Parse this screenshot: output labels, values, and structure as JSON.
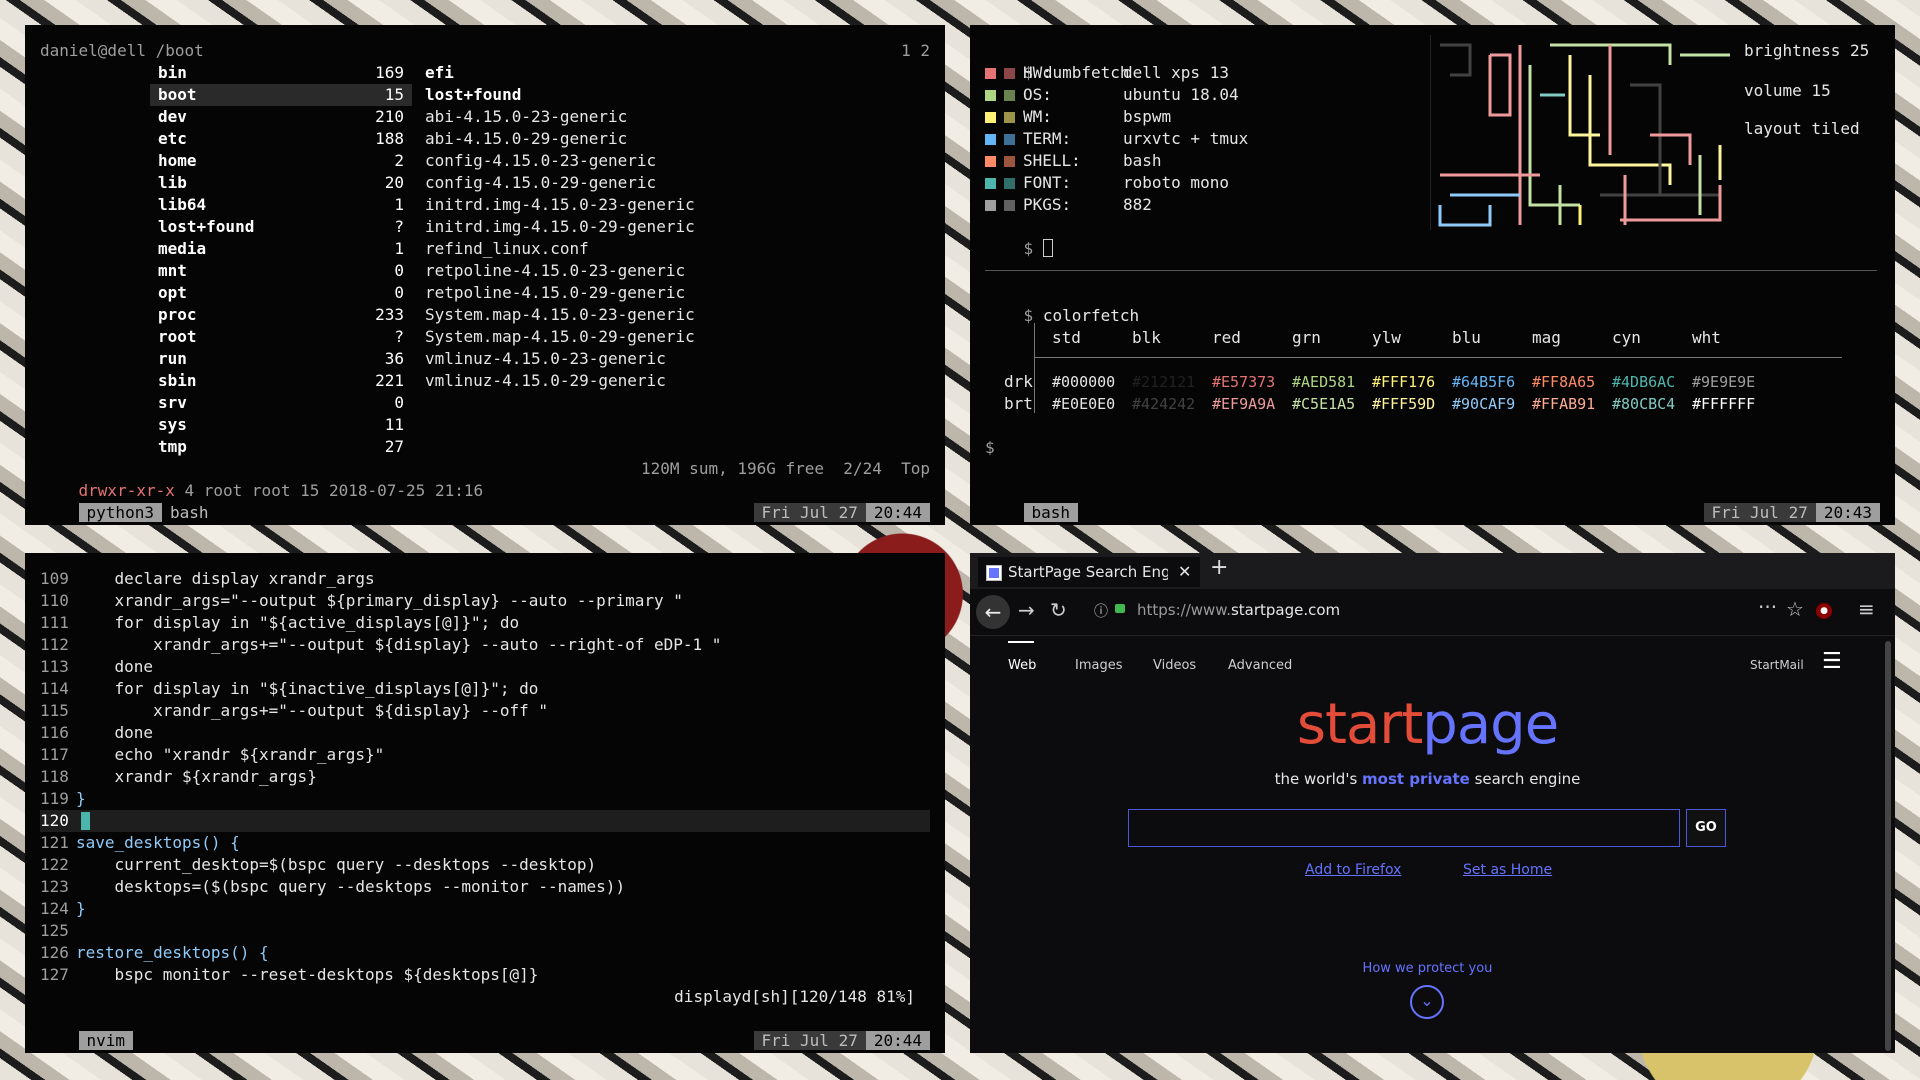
{
  "ranger": {
    "path": "daniel@dell /boot",
    "tabs": "1 2",
    "left_items": [
      {
        "name": "bin",
        "count": "169"
      },
      {
        "name": "boot",
        "count": "15",
        "selected": true
      },
      {
        "name": "dev",
        "count": "210"
      },
      {
        "name": "etc",
        "count": "188"
      },
      {
        "name": "home",
        "count": "2"
      },
      {
        "name": "lib",
        "count": "20"
      },
      {
        "name": "lib64",
        "count": "1"
      },
      {
        "name": "lost+found",
        "count": "?"
      },
      {
        "name": "media",
        "count": "1"
      },
      {
        "name": "mnt",
        "count": "0"
      },
      {
        "name": "opt",
        "count": "0"
      },
      {
        "name": "proc",
        "count": "233"
      },
      {
        "name": "root",
        "count": "?"
      },
      {
        "name": "run",
        "count": "36"
      },
      {
        "name": "sbin",
        "count": "221"
      },
      {
        "name": "srv",
        "count": "0"
      },
      {
        "name": "sys",
        "count": "11"
      },
      {
        "name": "tmp",
        "count": "27"
      }
    ],
    "right_items": [
      {
        "name": "efi",
        "bold": true
      },
      {
        "name": "lost+found",
        "bold": true
      },
      {
        "name": "abi-4.15.0-23-generic"
      },
      {
        "name": "abi-4.15.0-29-generic"
      },
      {
        "name": "config-4.15.0-23-generic"
      },
      {
        "name": "config-4.15.0-29-generic"
      },
      {
        "name": "initrd.img-4.15.0-23-generic"
      },
      {
        "name": "initrd.img-4.15.0-29-generic"
      },
      {
        "name": "refind_linux.conf"
      },
      {
        "name": "retpoline-4.15.0-23-generic"
      },
      {
        "name": "retpoline-4.15.0-29-generic"
      },
      {
        "name": "System.map-4.15.0-23-generic"
      },
      {
        "name": "System.map-4.15.0-29-generic"
      },
      {
        "name": "vmlinuz-4.15.0-23-generic"
      },
      {
        "name": "vmlinuz-4.15.0-29-generic"
      }
    ],
    "perm": "drwxr-xr-x",
    "info": " 4 root root 15 2018-07-25 21:16",
    "summary": "120M sum, 196G free  2/24  Top",
    "status_left": "python3",
    "status_left2": "bash",
    "date": "Fri Jul 27",
    "time": "20:44"
  },
  "fetch": {
    "prompt": "$",
    "cmd1": "dumbfetch",
    "items": [
      {
        "label": "HW:",
        "value": "dell xps 13",
        "color": "#E57373"
      },
      {
        "label": "OS:",
        "value": "ubuntu 18.04",
        "color": "#AED581"
      },
      {
        "label": "WM:",
        "value": "bspwm",
        "color": "#FFF176"
      },
      {
        "label": "TERM:",
        "value": "urxvtc + tmux",
        "color": "#64B5F6"
      },
      {
        "label": "SHELL:",
        "value": "bash",
        "color": "#FF8A65"
      },
      {
        "label": "FONT:",
        "value": "roboto mono",
        "color": "#4DB6AC"
      },
      {
        "label": "PKGS:",
        "value": "882",
        "color": "#9E9E9E"
      }
    ],
    "brightness": "brightness 25",
    "volume": "volume 15",
    "layout": "layout tiled",
    "cmd2": "colorfetch",
    "headers": [
      "std",
      "blk",
      "red",
      "grn",
      "ylw",
      "blu",
      "mag",
      "cyn",
      "wht"
    ],
    "drk_label": "drk",
    "brt_label": "brt",
    "drk": [
      "#000000",
      "#212121",
      "#E57373",
      "#AED581",
      "#FFF176",
      "#64B5F6",
      "#FF8A65",
      "#4DB6AC",
      "#9E9E9E"
    ],
    "brt": [
      "#E0E0E0",
      "#424242",
      "#EF9A9A",
      "#C5E1A5",
      "#FFF59D",
      "#90CAF9",
      "#FFAB91",
      "#80CBC4",
      "#FFFFFF"
    ],
    "status_left": "bash",
    "date": "Fri Jul 27",
    "time": "20:43"
  },
  "nvim": {
    "lines": [
      {
        "n": "109",
        "text": "    declare display xrandr_args"
      },
      {
        "n": "110",
        "text": "    xrandr_args=\"--output ${primary_display} --auto --primary \""
      },
      {
        "n": "111",
        "text": "    for display in \"${active_displays[@]}\"; do"
      },
      {
        "n": "112",
        "text": "        xrandr_args+=\"--output ${display} --auto --right-of eDP-1 \""
      },
      {
        "n": "113",
        "text": "    done"
      },
      {
        "n": "114",
        "text": "    for display in \"${inactive_displays[@]}\"; do"
      },
      {
        "n": "115",
        "text": "        xrandr_args+=\"--output ${display} --off \""
      },
      {
        "n": "116",
        "text": "    done"
      },
      {
        "n": "117",
        "text": "    echo \"xrandr ${xrandr_args}\""
      },
      {
        "n": "118",
        "text": "    xrandr ${xrandr_args}"
      },
      {
        "n": "119",
        "text": "}"
      },
      {
        "n": "120",
        "text": ""
      },
      {
        "n": "121",
        "text": "save_desktops() {"
      },
      {
        "n": "122",
        "text": "    current_desktop=$(bspc query --desktops --desktop)"
      },
      {
        "n": "123",
        "text": "    desktops=($(bspc query --desktops --monitor --names))"
      },
      {
        "n": "124",
        "text": "}"
      },
      {
        "n": "125",
        "text": ""
      },
      {
        "n": "126",
        "text": "restore_desktops() {"
      },
      {
        "n": "127",
        "text": "    bspc monitor --reset-desktops ${desktops[@]}"
      }
    ],
    "file_status": "displayd[sh][120/148 81%]",
    "status_left": "nvim",
    "date": "Fri Jul 27",
    "time": "20:44"
  },
  "browser": {
    "tab_title": "StartPage Search Engi",
    "url_prefix": "https://www.",
    "url_domain": "startpage.com",
    "nav_items": [
      "Web",
      "Images",
      "Videos",
      "Advanced"
    ],
    "startmail": "StartMail",
    "logo_start": "start",
    "logo_page": "page",
    "tagline_pre": "the world's ",
    "tagline_bold": "most private",
    "tagline_post": " search engine",
    "go": "GO",
    "add_firefox": "Add to Firefox",
    "set_home": "Set as Home",
    "how_protect": "How we protect you",
    "accent": "#6573ff",
    "logo_red": "#e44c3a"
  }
}
